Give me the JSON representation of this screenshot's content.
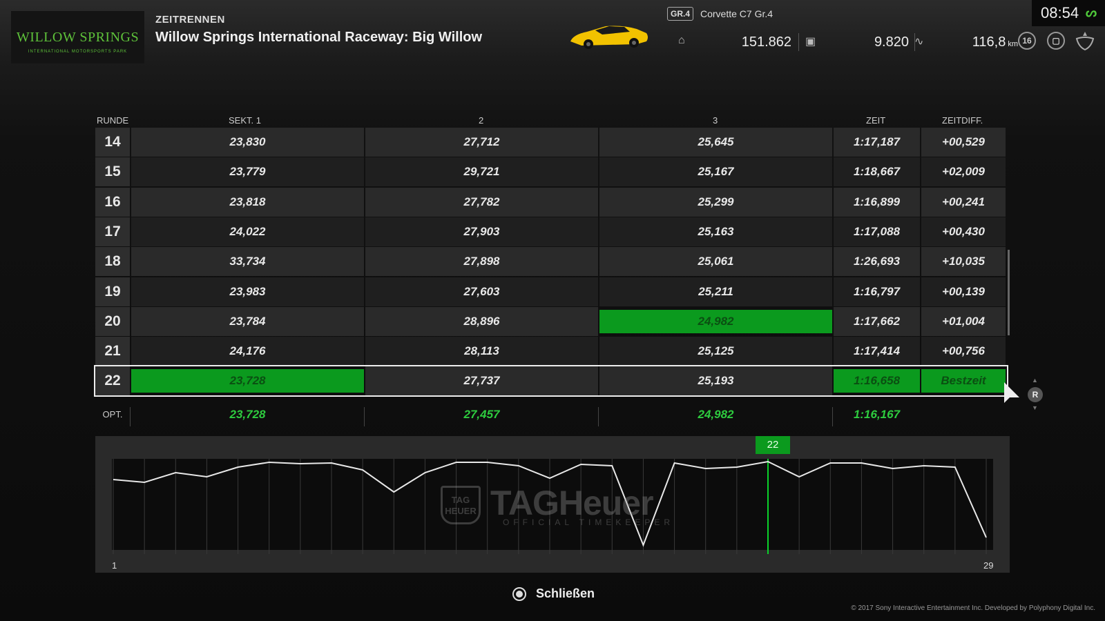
{
  "header": {
    "logo_text": "WILLOW SPRINGS",
    "logo_sub": "INTERNATIONAL MOTORSPORTS PARK",
    "mode": "ZEITRENNEN",
    "track": "Willow Springs International Raceway: Big Willow",
    "car_class": "GR.4",
    "car_name": "Corvette C7 Gr.4",
    "stat_points": "151.862",
    "stat_credits": "9.820",
    "stat_distance": "116,8",
    "stat_distance_unit": "km",
    "level": "16",
    "clock": "08:54"
  },
  "table": {
    "headers": {
      "lap": "RUNDE",
      "s1": "SEKT. 1",
      "s2": "2",
      "s3": "3",
      "time": "ZEIT",
      "diff": "ZEITDIFF."
    },
    "rows": [
      {
        "lap": "14",
        "s1": "23,830",
        "s2": "27,712",
        "s3": "25,645",
        "time": "1:17,187",
        "diff": "+00,529"
      },
      {
        "lap": "15",
        "s1": "23,779",
        "s2": "29,721",
        "s3": "25,167",
        "time": "1:18,667",
        "diff": "+02,009"
      },
      {
        "lap": "16",
        "s1": "23,818",
        "s2": "27,782",
        "s3": "25,299",
        "time": "1:16,899",
        "diff": "+00,241"
      },
      {
        "lap": "17",
        "s1": "24,022",
        "s2": "27,903",
        "s3": "25,163",
        "time": "1:17,088",
        "diff": "+00,430"
      },
      {
        "lap": "18",
        "s1": "33,734",
        "s2": "27,898",
        "s3": "25,061",
        "time": "1:26,693",
        "diff": "+10,035"
      },
      {
        "lap": "19",
        "s1": "23,983",
        "s2": "27,603",
        "s3": "25,211",
        "time": "1:16,797",
        "diff": "+00,139"
      },
      {
        "lap": "20",
        "s1": "23,784",
        "s2": "28,896",
        "s3": "24,982",
        "time": "1:17,662",
        "diff": "+01,004"
      },
      {
        "lap": "21",
        "s1": "24,176",
        "s2": "28,113",
        "s3": "25,125",
        "time": "1:17,414",
        "diff": "+00,756"
      },
      {
        "lap": "22",
        "s1": "23,728",
        "s2": "27,737",
        "s3": "25,193",
        "time": "1:16,658",
        "diff": "Bestzeit"
      }
    ],
    "optimal": {
      "label": "OPT.",
      "s1": "23,728",
      "s2": "27,457",
      "s3": "24,982",
      "time": "1:16,167"
    }
  },
  "graph": {
    "selected_lap": "22",
    "x_start": "1",
    "x_end": "29",
    "watermark": "TAGHeuer",
    "watermark_sub": "OFFICIAL TIMEKEEPER",
    "watermark_shield": "TAG HEUER"
  },
  "footer": {
    "close_label": "Schließen",
    "copyright": "© 2017 Sony Interactive Entertainment Inc. Developed by Polyphony Digital Inc."
  },
  "controls": {
    "r_label": "R"
  },
  "colors": {
    "accent_green": "#0b9a1e",
    "diff_red": "#e8315a",
    "opt_green": "#2ecc3f"
  }
}
